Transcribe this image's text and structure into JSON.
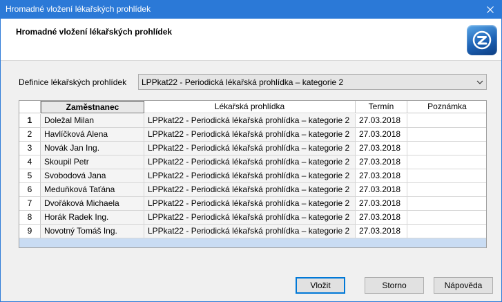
{
  "window": {
    "title": "Hromadné vložení lékařských prohlídek"
  },
  "header": {
    "heading": "Hromadné vložení lékařských prohlídek"
  },
  "definition": {
    "label": "Definice lékařských prohlídek",
    "selected": "LPPkat22 - Periodická lékařská prohlídka – kategorie 2"
  },
  "grid": {
    "columns": [
      "Zaměstnanec",
      "Lékařská prohlídka",
      "Termín",
      "Poznámka"
    ],
    "rows": [
      {
        "num": "1",
        "employee": "Doležal Milan",
        "exam": "LPPkat22 - Periodická lékařská prohlídka – kategorie 2",
        "date": "27.03.2018",
        "note": ""
      },
      {
        "num": "2",
        "employee": "Havlíčková Alena",
        "exam": "LPPkat22 - Periodická lékařská prohlídka – kategorie 2",
        "date": "27.03.2018",
        "note": ""
      },
      {
        "num": "3",
        "employee": "Novák Jan Ing.",
        "exam": "LPPkat22 - Periodická lékařská prohlídka – kategorie 2",
        "date": "27.03.2018",
        "note": ""
      },
      {
        "num": "4",
        "employee": "Skoupil Petr",
        "exam": "LPPkat22 - Periodická lékařská prohlídka – kategorie 2",
        "date": "27.03.2018",
        "note": ""
      },
      {
        "num": "5",
        "employee": "Svobodová Jana",
        "exam": "LPPkat22 - Periodická lékařská prohlídka – kategorie 2",
        "date": "27.03.2018",
        "note": ""
      },
      {
        "num": "6",
        "employee": "Meduňková Taťána",
        "exam": "LPPkat22 - Periodická lékařská prohlídka – kategorie 2",
        "date": "27.03.2018",
        "note": ""
      },
      {
        "num": "7",
        "employee": "Dvořáková Michaela",
        "exam": "LPPkat22 - Periodická lékařská prohlídka – kategorie 2",
        "date": "27.03.2018",
        "note": ""
      },
      {
        "num": "8",
        "employee": "Horák Radek Ing.",
        "exam": "LPPkat22 - Periodická lékařská prohlídka – kategorie 2",
        "date": "27.03.2018",
        "note": ""
      },
      {
        "num": "9",
        "employee": "Novotný Tomáš Ing.",
        "exam": "LPPkat22 - Periodická lékařská prohlídka – kategorie 2",
        "date": "27.03.2018",
        "note": ""
      }
    ]
  },
  "buttons": {
    "insert": "Vložit",
    "cancel": "Storno",
    "help": "Nápověda"
  },
  "icons": {
    "close": "close-icon",
    "logo": "app-logo-icon",
    "dropdown": "chevron-down-icon"
  },
  "colors": {
    "titlebar": "#2b79d7",
    "accent": "#0078d7",
    "grid_footer": "#c9dcf3"
  }
}
